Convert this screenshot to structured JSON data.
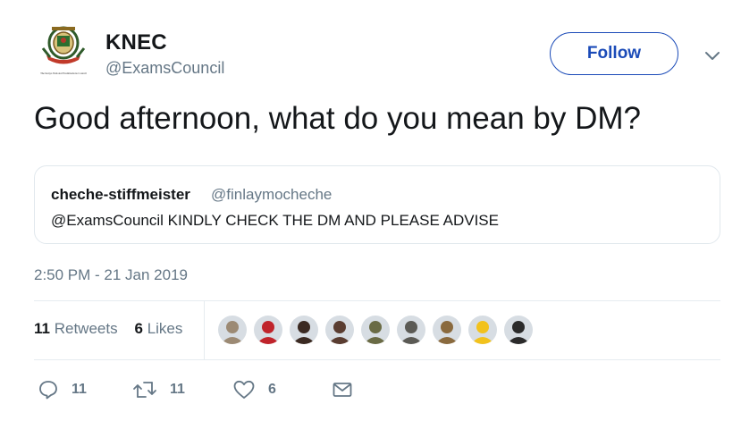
{
  "author": {
    "display_name": "KNEC",
    "handle": "@ExamsCouncil",
    "avatar_icon": "knec-crest-logo",
    "logo_caption": "The Kenya National Examinations Council"
  },
  "follow_button": {
    "label": "Follow"
  },
  "menu": {
    "icon": "chevron-down-icon"
  },
  "tweet": {
    "text": "Good afternoon, what do you mean by DM?"
  },
  "quoted_tweet": {
    "display_name": "cheche-stiffmeister",
    "handle": "@finlaymocheche",
    "text": "@ExamsCouncil KINDLY CHECK THE DM AND PLEASE ADVISE"
  },
  "timestamp": "2:50 PM - 21 Jan 2019",
  "stats": {
    "retweets_count": "11",
    "retweets_label": "Retweets",
    "likes_count": "6",
    "likes_label": "Likes"
  },
  "liker_avatars": [
    {
      "name": "liker-avatar-1",
      "color": "#9c8a74"
    },
    {
      "name": "liker-avatar-2",
      "color": "#c0242b"
    },
    {
      "name": "liker-avatar-3",
      "color": "#3b2a22"
    },
    {
      "name": "liker-avatar-4",
      "color": "#5a3d31"
    },
    {
      "name": "liker-avatar-5",
      "color": "#6a6b45"
    },
    {
      "name": "liker-avatar-6",
      "color": "#5b5a55"
    },
    {
      "name": "liker-avatar-7",
      "color": "#8a6a3e"
    },
    {
      "name": "liker-avatar-8",
      "color": "#f2c21d"
    },
    {
      "name": "liker-avatar-9",
      "color": "#2b2b2b"
    }
  ],
  "actions": {
    "reply_count": "11",
    "retweet_count": "11",
    "like_count": "6"
  },
  "colors": {
    "accent": "#1b4bb8",
    "secondary_text": "#657786",
    "border": "#e1e8ed"
  }
}
